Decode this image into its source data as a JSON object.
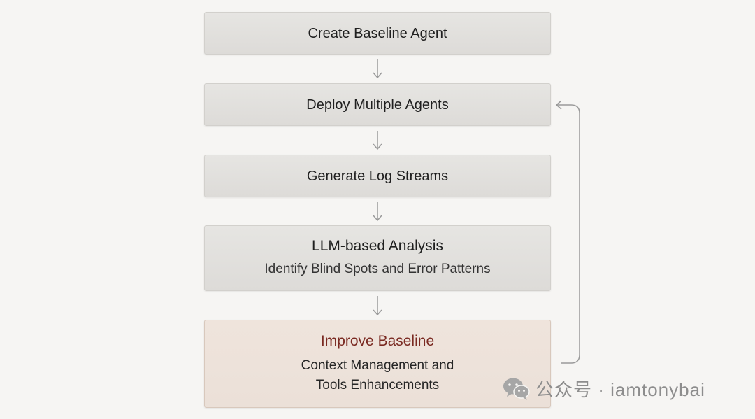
{
  "steps": [
    {
      "label": "Create Baseline Agent"
    },
    {
      "label": "Deploy Multiple Agents"
    },
    {
      "label": "Generate Log Streams"
    },
    {
      "label": "LLM-based Analysis",
      "sub": "Identify Blind Spots and Error Patterns"
    },
    {
      "label": "Improve Baseline",
      "sub_lines": [
        "Context Management and",
        "Tools Enhancements"
      ]
    }
  ],
  "colors": {
    "background": "#f6f5f3",
    "box_fill": "#e2e1de",
    "highlight_fill": "#ede2da",
    "highlight_text": "#7a2a22",
    "arrow": "#9a9a9a",
    "watermark": "#8d8d8d"
  },
  "watermark": {
    "icon": "wechat-icon",
    "text": "公众号 · iamtonybai"
  }
}
